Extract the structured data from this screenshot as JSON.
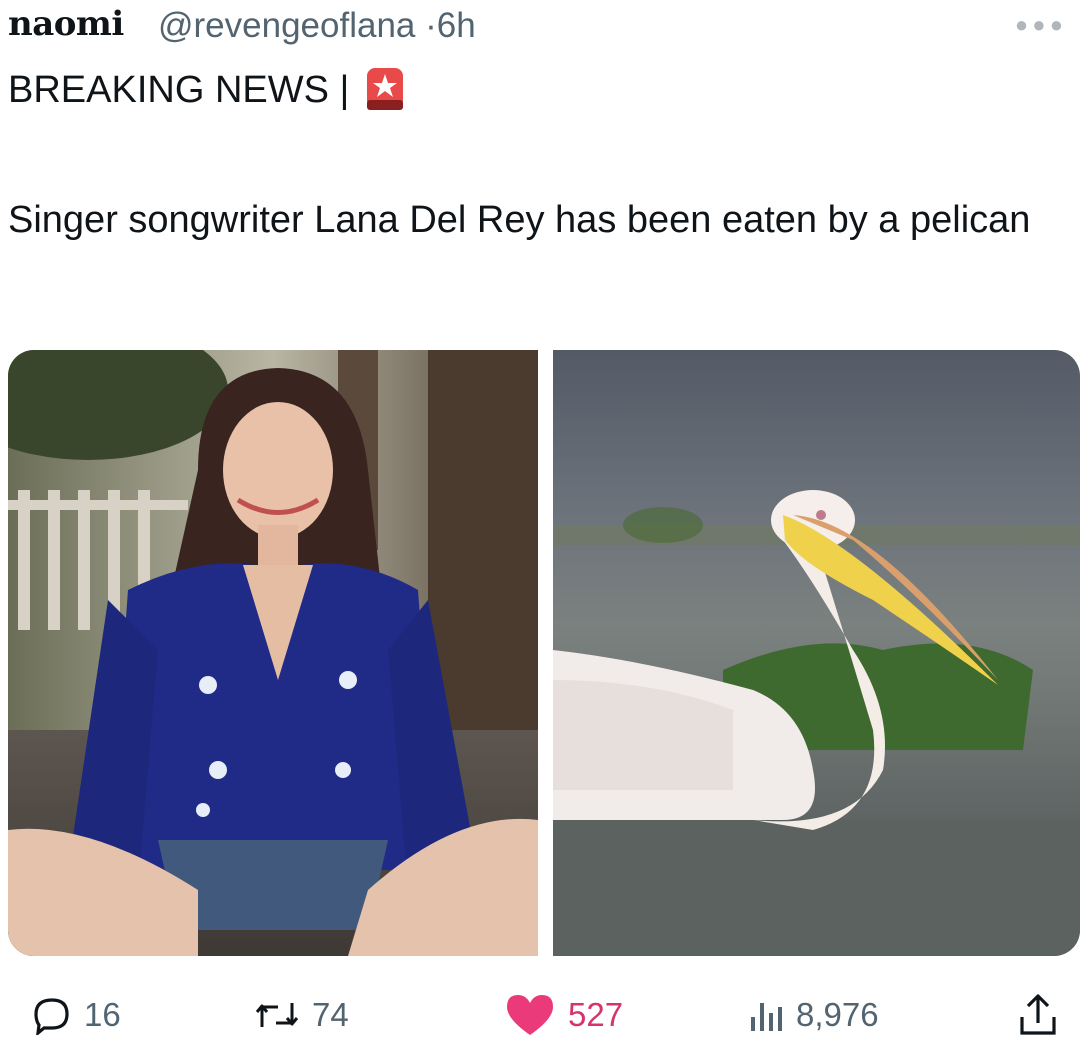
{
  "tweet": {
    "display_name": "naomi",
    "handle": "@revengeoflana",
    "separator": "·",
    "time": "6h",
    "headline": "BREAKING NEWS |",
    "body": "Singer songwriter Lana Del Rey has been eaten by a pelican",
    "more_icon": "ellipsis-icon"
  },
  "images": [
    {
      "subject": "woman-portrait-photo"
    },
    {
      "subject": "pelican-photo"
    }
  ],
  "actions": {
    "replies": "16",
    "reposts": "74",
    "likes": "527",
    "views": "8,976"
  },
  "colors": {
    "like_accent": "#d7336f",
    "muted_text": "#536471",
    "siren_red": "#d42a2a"
  }
}
